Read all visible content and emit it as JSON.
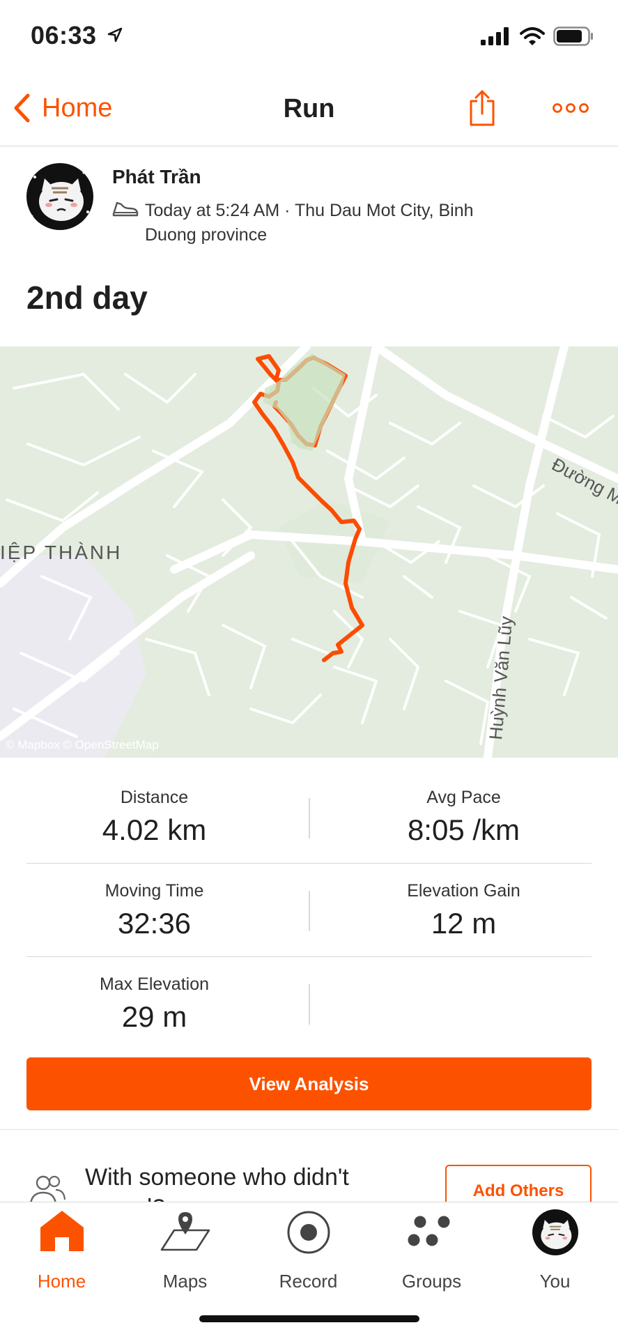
{
  "status_bar": {
    "time": "06:33"
  },
  "nav": {
    "back_label": "Home",
    "title": "Run"
  },
  "activity": {
    "athlete_name": "Phát Trần",
    "meta": "Today at 5:24 AM · Thu Dau Mot City, Binh Duong province",
    "title": "2nd day"
  },
  "map": {
    "labels": {
      "district": "IỆP THÀNH",
      "road_1": "Huỳnh Văn Lũy",
      "road_2": "Đường M"
    },
    "attribution": "© Mapbox © OpenStreetMap",
    "route_color": "#fc4c02"
  },
  "stats": [
    {
      "label": "Distance",
      "value": "4.02 km"
    },
    {
      "label": "Avg Pace",
      "value": "8:05 /km"
    },
    {
      "label": "Moving Time",
      "value": "32:36"
    },
    {
      "label": "Elevation Gain",
      "value": "12 m"
    },
    {
      "label": "Max Elevation",
      "value": "29 m"
    }
  ],
  "actions": {
    "view_analysis": "View Analysis",
    "with_someone": "With someone who didn't record?",
    "add_others": "Add Others"
  },
  "tabs": [
    {
      "label": "Home",
      "icon": "home-icon",
      "active": true
    },
    {
      "label": "Maps",
      "icon": "maps-icon"
    },
    {
      "label": "Record",
      "icon": "record-icon"
    },
    {
      "label": "Groups",
      "icon": "groups-icon"
    },
    {
      "label": "You",
      "icon": "avatar"
    }
  ],
  "colors": {
    "accent": "#fc5200",
    "map_bg": "#e7efe3"
  }
}
